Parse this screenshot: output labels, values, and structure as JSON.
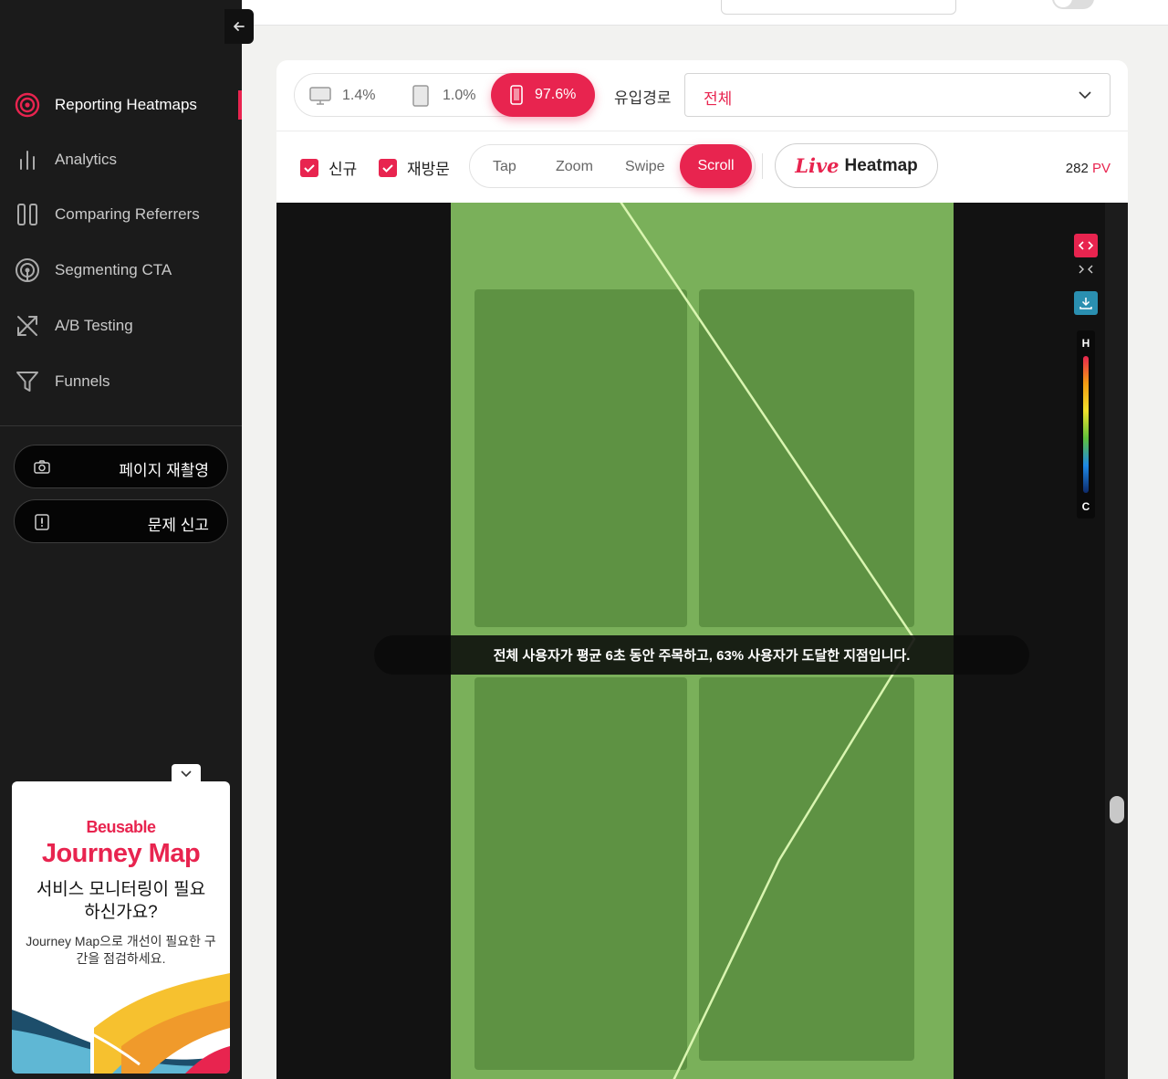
{
  "sidebar": {
    "items": [
      {
        "label": "Reporting Heatmaps",
        "icon": "target-icon",
        "active": true
      },
      {
        "label": "Analytics",
        "icon": "bar-chart-icon"
      },
      {
        "label": "Comparing Referrers",
        "icon": "columns-icon"
      },
      {
        "label": "Segmenting CTA",
        "icon": "broadcast-icon"
      },
      {
        "label": "A/B Testing",
        "icon": "shuffle-icon"
      },
      {
        "label": "Funnels",
        "icon": "funnel-icon"
      }
    ],
    "buttons": [
      {
        "label": "페이지 재촬영",
        "icon": "camera-icon"
      },
      {
        "label": "문제 신고",
        "icon": "alert-icon"
      }
    ],
    "promo": {
      "brand": "Beusable",
      "product": "Journey Map",
      "headline": "서비스 모니터링이 필요하신가요?",
      "desc": "Journey Map으로 개선이 필요한 구간을 점검하세요."
    }
  },
  "toolbar": {
    "devices": [
      {
        "name": "desktop",
        "percent": "1.4%",
        "icon": "desktop-icon"
      },
      {
        "name": "tablet",
        "percent": "1.0%",
        "icon": "tablet-icon"
      },
      {
        "name": "mobile",
        "percent": "97.6%",
        "icon": "mobile-icon",
        "active": true
      }
    ],
    "referrer_label": "유입경로",
    "referrer_value": "전체",
    "filters": [
      {
        "label": "신규",
        "checked": true
      },
      {
        "label": "재방문",
        "checked": true
      }
    ],
    "heatmap_types": [
      "Tap",
      "Zoom",
      "Swipe",
      "Scroll"
    ],
    "active_type": "Scroll",
    "live_label": "Live",
    "live_heatmap_label": "Heatmap",
    "pv_count": "282",
    "pv_unit": "PV"
  },
  "viewer": {
    "info_text": "전체 사용자가 평균 6초 동안 주목하고, 63% 사용자가 도달한 지점입니다.",
    "legend_high": "H",
    "legend_low": "C"
  },
  "colors": {
    "accent": "#e8244f",
    "sidebar_bg": "#1b1b1b",
    "heat_green": "#7ab05a",
    "control_teal": "#2a8fb0"
  }
}
